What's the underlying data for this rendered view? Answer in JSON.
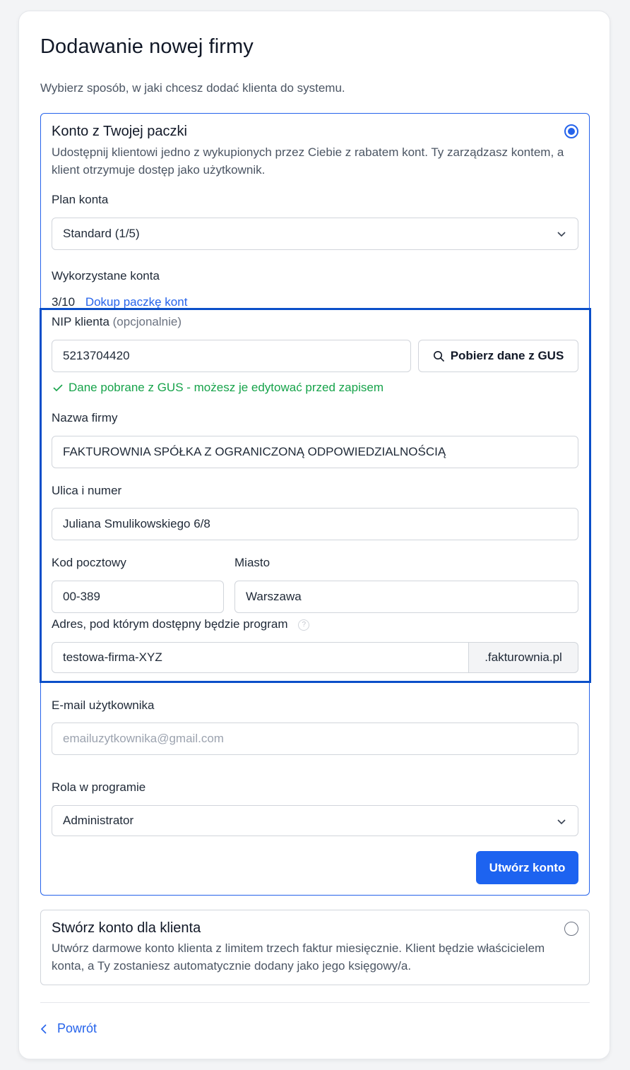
{
  "page": {
    "title": "Dodawanie nowej firmy",
    "subtitle": "Wybierz sposób, w jaki chcesz dodać klienta do systemu."
  },
  "option_package": {
    "title": "Konto z Twojej paczki",
    "description": "Udostępnij klientowi jedno z wykupionych przez Ciebie z rabatem kont. Ty zarządzasz kontem, a klient otrzymuje dostęp jako użytkownik.",
    "selected": true,
    "plan_label": "Plan konta",
    "plan_value": "Standard (1/5)",
    "used_label": "Wykorzystane konta",
    "used_value": "3/10",
    "buy_more_link": "Dokup paczkę kont",
    "nip_label": "NIP klienta",
    "nip_optional": "(opcjonalnie)",
    "nip_value": "5213704420",
    "gus_button": "Pobierz dane z GUS",
    "gus_success": "Dane pobrane z GUS - możesz je edytować przed zapisem",
    "company_label": "Nazwa firmy",
    "company_value": "FAKTUROWNIA SPÓŁKA Z OGRANICZONĄ ODPOWIEDZIALNOŚCIĄ",
    "street_label": "Ulica i numer",
    "street_value": "Juliana Smulikowskiego 6/8",
    "zip_label": "Kod pocztowy",
    "zip_value": "00-389",
    "city_label": "Miasto",
    "city_value": "Warszawa",
    "address_label": "Adres, pod którym dostępny będzie program",
    "help_glyph": "?",
    "subdomain_value": "testowa-firma-XYZ",
    "subdomain_suffix": ".fakturownia.pl",
    "email_label": "E-mail użytkownika",
    "email_placeholder": "emailuzytkownika@gmail.com",
    "role_label": "Rola w programie",
    "role_value": "Administrator",
    "submit_button": "Utwórz konto"
  },
  "option_client": {
    "title": "Stwórz konto dla klienta",
    "description": "Utwórz darmowe konto klienta z limitem trzech faktur miesięcznie. Klient będzie właścicielem konta, a Ty zostaniesz automatycznie dodany jako jego księgowy/a.",
    "selected": false
  },
  "footer": {
    "back_link": "Powrót"
  },
  "colors": {
    "accent": "#2563eb",
    "primary_button": "#1d63f0",
    "success": "#16a34a",
    "highlight_border": "#0b4fc9"
  },
  "icons": [
    "chevron-down-icon",
    "search-icon",
    "check-icon",
    "help-icon",
    "chevron-left-icon",
    "radio-selected-icon",
    "radio-unselected-icon"
  ]
}
